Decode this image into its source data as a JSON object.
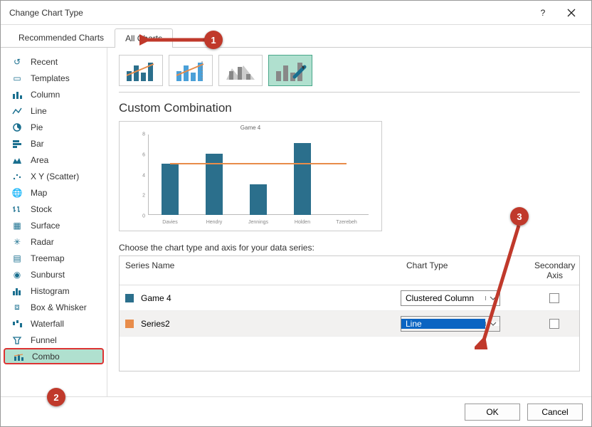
{
  "title": "Change Chart Type",
  "tabs": {
    "recommended": "Recommended Charts",
    "all": "All Charts"
  },
  "sidebar": {
    "items": [
      {
        "label": "Recent"
      },
      {
        "label": "Templates"
      },
      {
        "label": "Column"
      },
      {
        "label": "Line"
      },
      {
        "label": "Pie"
      },
      {
        "label": "Bar"
      },
      {
        "label": "Area"
      },
      {
        "label": "X Y (Scatter)"
      },
      {
        "label": "Map"
      },
      {
        "label": "Stock"
      },
      {
        "label": "Surface"
      },
      {
        "label": "Radar"
      },
      {
        "label": "Treemap"
      },
      {
        "label": "Sunburst"
      },
      {
        "label": "Histogram"
      },
      {
        "label": "Box & Whisker"
      },
      {
        "label": "Waterfall"
      },
      {
        "label": "Funnel"
      },
      {
        "label": "Combo"
      }
    ]
  },
  "main": {
    "subtype_header": "Custom Combination",
    "choose_label": "Choose the chart type and axis for your data series:",
    "columns": {
      "series": "Series Name",
      "type": "Chart Type",
      "secondary": "Secondary Axis"
    },
    "rows": [
      {
        "swatch": "#2b6f8c",
        "name": "Game 4",
        "type": "Clustered Column",
        "secondary": false,
        "highlight": false
      },
      {
        "swatch": "#e88c4a",
        "name": "Series2",
        "type": "Line",
        "secondary": false,
        "highlight": true
      }
    ]
  },
  "buttons": {
    "ok": "OK",
    "cancel": "Cancel"
  },
  "annotations": {
    "a1": "1",
    "a2": "2",
    "a3": "3"
  },
  "chart_data": {
    "type": "combo",
    "title": "Game 4",
    "categories": [
      "Davies",
      "Hendry",
      "Jennings",
      "Holden",
      "Tzerebeh"
    ],
    "series": [
      {
        "name": "Game 4",
        "type": "bar",
        "values": [
          5,
          6,
          3,
          7,
          0
        ],
        "color": "#2b6f8c"
      },
      {
        "name": "Series2",
        "type": "line",
        "values": [
          5.2,
          5.2,
          5.2,
          5.2,
          5.2
        ],
        "color": "#e88c4a"
      }
    ],
    "ylim": [
      0,
      8
    ],
    "yticks": [
      0,
      2,
      4,
      6,
      8
    ]
  }
}
